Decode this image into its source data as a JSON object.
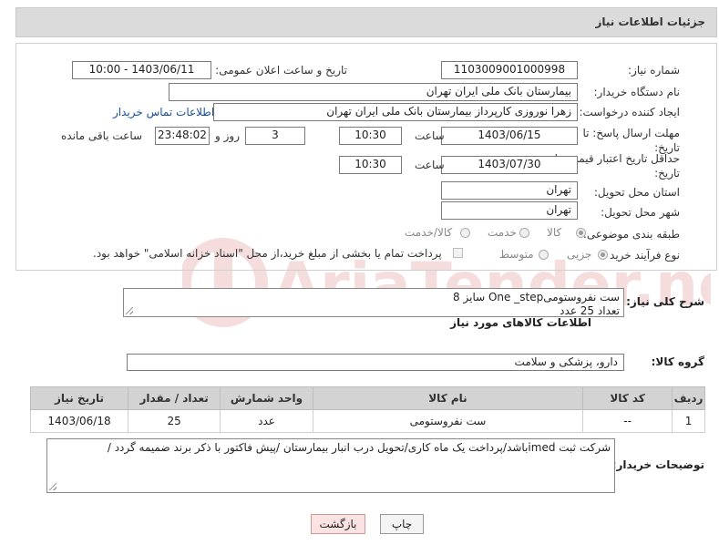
{
  "header": {
    "title": "جزئیات اطلاعات نیاز"
  },
  "form": {
    "need_number_label": "شماره نیاز:",
    "need_number": "1103009001000998",
    "announce_label": "تاریخ و ساعت اعلان عمومی:",
    "announce_value": "1403/06/11 - 10:00",
    "buyer_org_label": "نام دستگاه خریدار:",
    "buyer_org": "بیمارستان بانک ملی ایران تهران",
    "creator_label": "ایجاد کننده درخواست:",
    "creator": "زهرا نوروزی کارپرداز بیمارستان بانک ملی ایران تهران",
    "contact_link": "اطلاعات تماس خریدار",
    "deadline_label": "مهلت ارسال پاسخ: تا تاریخ:",
    "deadline_date": "1403/06/15",
    "time_label": "ساعت",
    "deadline_time": "10:30",
    "days_value": "3",
    "days_label": "روز و",
    "remaining_time": "23:48:02",
    "remaining_label": "ساعت باقی مانده",
    "validity_label": "حداقل تاریخ اعتبار قیمت: تا تاریخ:",
    "validity_date": "1403/07/30",
    "validity_time": "10:30",
    "province_label": "استان محل تحویل:",
    "province": "تهران",
    "city_label": "شهر محل تحویل:",
    "city": "تهران",
    "category_label": "طبقه بندی موضوعی:",
    "category_options": [
      "کالا",
      "خدمت",
      "کالا/خدمت"
    ],
    "process_label": "نوع فرآیند خرید :",
    "process_options": [
      "جزیی",
      "متوسط"
    ],
    "payment_note": "پرداخت تمام یا بخشی از مبلغ خرید،از محل \"اسناد خزانه اسلامی\" خواهد بود."
  },
  "description": {
    "label": "شرح کلی نیاز:",
    "line1": "ست نفروستومیOne _step سایز 8",
    "line2": "تعداد 25 عدد"
  },
  "goods": {
    "section_title": "اطلاعات کالاهای مورد نیاز",
    "group_label": "گروه کالا:",
    "group_value": "دارو، پزشکی و سلامت",
    "headers": [
      "ردیف",
      "کد کالا",
      "نام کالا",
      "واحد شمارش",
      "تعداد / مقدار",
      "تاریخ نیاز"
    ],
    "rows": [
      [
        "1",
        "--",
        "ست نفروستومی",
        "عدد",
        "25",
        "1403/06/18"
      ]
    ]
  },
  "buyer_notes": {
    "label": "توضیحات خریدار:",
    "text": "شرکت ثبت imedباشد/پرداخت یک ماه کاری/تحویل درب انبار بیمارستان /پیش فاکتور با ذکر برند ضمیمه گردد /"
  },
  "buttons": {
    "print": "چاپ",
    "back": "بازگشت"
  },
  "watermark": {
    "text": "AriaTender.neT"
  }
}
